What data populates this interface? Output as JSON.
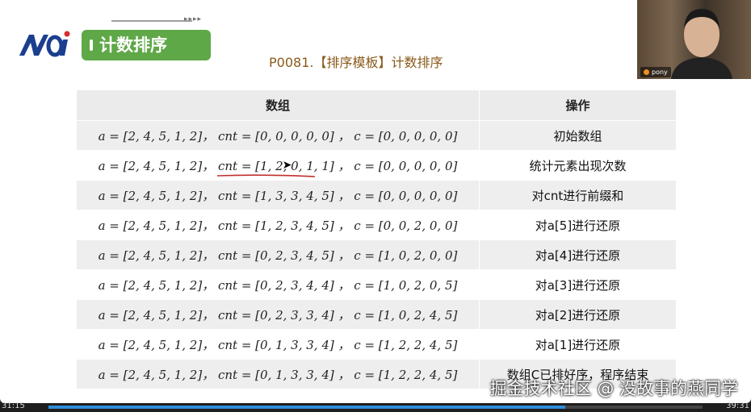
{
  "header": {
    "logo_text": "NOI",
    "section_title": "计数排序",
    "problem_title": "P0081.【排序模板】计数排序"
  },
  "table": {
    "headers": [
      "数组",
      "操作"
    ],
    "rows": [
      {
        "math": "a = [2, 4, 5, 1, 2]， cnt = [0, 0, 0, 0, 0] ， c = [0, 0, 0, 0, 0]",
        "op": "初始数组"
      },
      {
        "math": "a = [2, 4, 5, 1, 2]， cnt = [1, 2, 0, 1, 1] ， c = [0, 0, 0, 0, 0]",
        "op": "统计元素出现次数"
      },
      {
        "math": "a = [2, 4, 5, 1, 2]， cnt = [1, 3, 3, 4, 5] ， c = [0, 0, 0, 0, 0]",
        "op": "对cnt进行前缀和"
      },
      {
        "math": "a = [2, 4, 5, 1, 2]， cnt = [1, 2, 3, 4, 5] ， c = [0, 0, 2, 0, 0]",
        "op": "对a[5]进行还原"
      },
      {
        "math": "a = [2, 4, 5, 1, 2]， cnt = [0, 2, 3, 4, 5] ， c = [1, 0, 2, 0, 0]",
        "op": "对a[4]进行还原"
      },
      {
        "math": "a = [2, 4, 5, 1, 2]， cnt = [0, 2, 3, 4, 4] ， c = [1, 0, 2, 0, 5]",
        "op": "对a[3]进行还原"
      },
      {
        "math": "a = [2, 4, 5, 1, 2]， cnt = [0, 2, 3, 3, 4] ， c = [1, 0, 2, 4, 5]",
        "op": "对a[2]进行还原"
      },
      {
        "math": "a = [2, 4, 5, 1, 2]， cnt = [0, 1, 3, 3, 4] ， c = [1, 2, 2, 4, 5]",
        "op": "对a[1]进行还原"
      },
      {
        "math": "a = [2, 4, 5, 1, 2]， cnt = [0, 1, 3, 3, 4] ， c = [1, 2, 2, 4, 5]",
        "op": "数组C已排好序，程序结束"
      }
    ]
  },
  "video": {
    "name": "pony"
  },
  "watermark": "掘金技术社区 @ 没故事的燕同学",
  "player": {
    "time_left": "31:15",
    "time_right": "39:31",
    "progress": 0.79
  },
  "colors": {
    "accent_green": "#5fa848",
    "title_brown": "#8a5a1a",
    "logo_blue": "#1b3f8f",
    "logo_red": "#d32f2f",
    "annotation_red": "#c0302c"
  }
}
